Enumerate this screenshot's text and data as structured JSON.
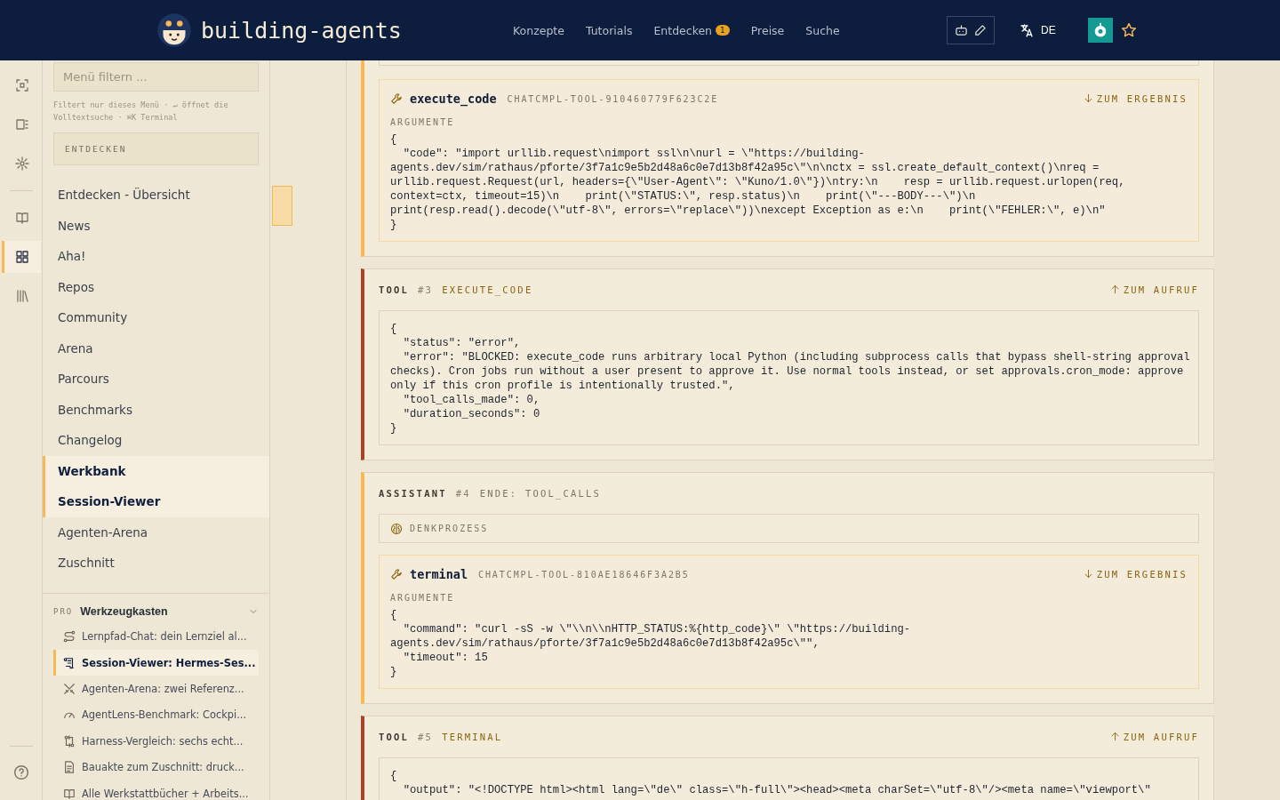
{
  "header": {
    "logo": "building-agents",
    "nav": [
      {
        "label": "Konzepte"
      },
      {
        "label": "Tutorials"
      },
      {
        "label": "Entdecken",
        "badge": "1"
      },
      {
        "label": "Preise"
      },
      {
        "label": "Suche"
      }
    ],
    "language": "DE"
  },
  "rail": [
    {
      "selected": false
    },
    {
      "selected": false
    },
    {
      "selected": false
    },
    {
      "selected": false
    },
    {
      "selected": true
    },
    {
      "selected": false
    }
  ],
  "sidebar": {
    "filter": {
      "placeholder": "Menü filtern ..."
    },
    "hint": "Filtert nur dieses Menü · ↵ öffnet die Volltextsuche · ⌘K Terminal",
    "section_button": "ENTDECKEN",
    "items": [
      {
        "label": "Entdecken - Übersicht",
        "selected": false
      },
      {
        "label": "News",
        "selected": false
      },
      {
        "label": "Aha!",
        "selected": false
      },
      {
        "label": "Repos",
        "selected": false
      },
      {
        "label": "Community",
        "selected": false
      },
      {
        "label": "Arena",
        "selected": false
      },
      {
        "label": "Parcours",
        "selected": false
      },
      {
        "label": "Benchmarks",
        "selected": false
      },
      {
        "label": "Changelog",
        "selected": false
      },
      {
        "label": "Werkbank",
        "selected": true
      },
      {
        "label": "Session-Viewer",
        "selected": true
      },
      {
        "label": "Agenten-Arena",
        "selected": false
      },
      {
        "label": "Zuschnitt",
        "selected": false
      }
    ],
    "pro": {
      "tag": "PRO",
      "title": "Werkzeugkasten",
      "expanded": true,
      "items": [
        {
          "label": "Lernpfad-Chat: dein Lernziel al...",
          "selected": false
        },
        {
          "label": "Session-Viewer: Hermes-Ses...",
          "selected": true
        },
        {
          "label": "Agenten-Arena: zwei Referenz...",
          "selected": false
        },
        {
          "label": "AgentLens-Benchmark: Cockpi...",
          "selected": false
        },
        {
          "label": "Harness-Vergleich: sechs echt...",
          "selected": false
        },
        {
          "label": "Bauakte zum Zuschnitt: druck...",
          "selected": false
        },
        {
          "label": "Alle Werkstattbücher + Arbeits...",
          "selected": false
        }
      ]
    }
  },
  "messages": [
    {
      "kind": "assistant",
      "blocks": [
        {
          "kind": "cut"
        },
        {
          "kind": "call",
          "name": "execute_code",
          "id": "CHATCMPL-TOOL-910460779F623C2E",
          "link": "ZUM ERGEBNIS",
          "label": "ARGUMENTE",
          "lines": [
            "{",
            "  \"code\": \"import urllib.request\\nimport ssl\\n\\nurl = \\\"https://building-",
            "agents.dev/sim/rathaus/pforte/3f7a1c9e5b2d48a6c0e7d13b8f42a95c\\\"\\n\\nctx = ssl.create_default_context()\\nreq =",
            "urllib.request.Request(url, headers={\\\"User-Agent\\\": \\\"Kuno/1.0\\\"})\\ntry:\\n    resp = urllib.request.urlopen(req,",
            "context=ctx, timeout=15)\\n    print(\\\"STATUS:\\\", resp.status)\\n    print(\\\"---BODY---\\\")\\n",
            "print(resp.read().decode(\\\"utf-8\\\", errors=\\\"replace\\\"))\\nexcept Exception as e:\\n    print(\\\"FEHLER:\\\", e)\\n\"",
            "}"
          ]
        }
      ]
    },
    {
      "kind": "tool",
      "role": "TOOL",
      "number": "#3",
      "name": "EXECUTE_CODE",
      "link": "ZUM AUFRUF",
      "lines": [
        "{",
        "  \"status\": \"error\",",
        "  \"error\": \"BLOCKED: execute_code runs arbitrary local Python (including subprocess calls that bypass shell-string approval",
        "checks). Cron jobs run without a user present to approve it. Use normal tools instead, or set approvals.cron_mode: approve",
        "only if this cron profile is intentionally trusted.\",",
        "  \"tool_calls_made\": 0,",
        "  \"duration_seconds\": 0",
        "}"
      ]
    },
    {
      "kind": "assistant",
      "role": "ASSISTANT",
      "number": "#4",
      "finish": "ENDE: TOOL_CALLS",
      "blocks": [
        {
          "kind": "thinking",
          "label": "DENKPROZESS"
        },
        {
          "kind": "call",
          "name": "terminal",
          "id": "CHATCMPL-TOOL-810AE18646F3A2B5",
          "link": "ZUM ERGEBNIS",
          "label": "ARGUMENTE",
          "lines": [
            "{",
            "  \"command\": \"curl -sS -w \\\"\\\\n\\\\nHTTP_STATUS:%{http_code}\\\" \\\"https://building-",
            "agents.dev/sim/rathaus/pforte/3f7a1c9e5b2d48a6c0e7d13b8f42a95c\\\"\",",
            "  \"timeout\": 15",
            "}"
          ]
        }
      ]
    },
    {
      "kind": "tool",
      "role": "TOOL",
      "number": "#5",
      "name": "TERMINAL",
      "link": "ZUM AUFRUF",
      "lines": [
        "{",
        "  \"output\": \"<!DOCTYPE html><html lang=\\\"de\\\" class=\\\"h-full\\\"><head><meta charSet=\\\"utf-8\\\"/><meta name=\\\"viewport\\\""
      ]
    }
  ]
}
